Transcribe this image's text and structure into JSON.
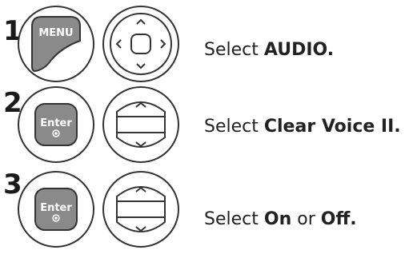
{
  "steps": [
    {
      "number": "1",
      "key_label": "MENU",
      "key_icon": "menu-key",
      "nav_icon": "four-way-nav-pad",
      "text_prefix": "Select",
      "text_bold": "AUDIO.",
      "text_mid": "",
      "text_bold2": ""
    },
    {
      "number": "2",
      "key_label": "Enter",
      "key_icon": "enter-key",
      "nav_icon": "up-down-nav-pad",
      "text_prefix": "Select",
      "text_bold": "Clear Voice II.",
      "text_mid": "",
      "text_bold2": ""
    },
    {
      "number": "3",
      "key_label": "Enter",
      "key_icon": "enter-key",
      "nav_icon": "up-down-nav-pad",
      "text_prefix": "Select",
      "text_bold": "On",
      "text_mid": "or",
      "text_bold2": "Off."
    }
  ],
  "colors": {
    "key_fill": "#8a8a8a",
    "outline": "#333333",
    "pad_fill": "#ffffff"
  }
}
